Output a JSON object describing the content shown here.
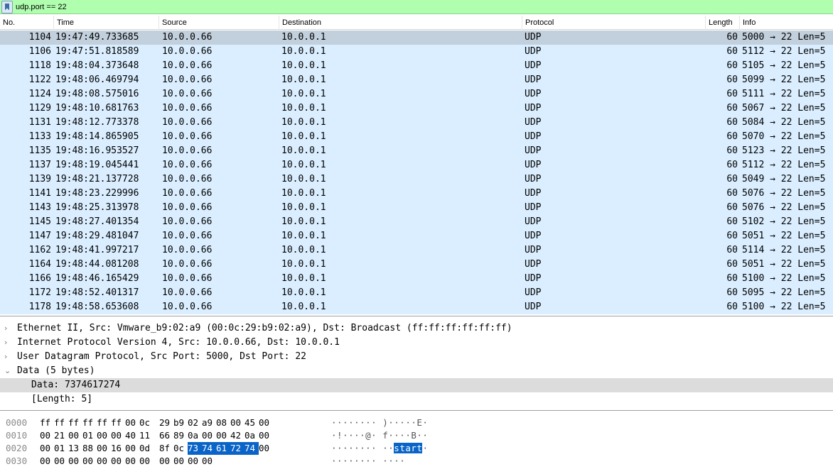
{
  "filter": {
    "value": "udp.port == 22"
  },
  "columns": [
    "No.",
    "Time",
    "Source",
    "Destination",
    "Protocol",
    "Length",
    "Info"
  ],
  "packets": [
    {
      "no": "1104",
      "time": "19:47:49.733685",
      "src": "10.0.0.66",
      "dst": "10.0.0.1",
      "proto": "UDP",
      "len": "60",
      "info": "5000 → 22 Len=5"
    },
    {
      "no": "1106",
      "time": "19:47:51.818589",
      "src": "10.0.0.66",
      "dst": "10.0.0.1",
      "proto": "UDP",
      "len": "60",
      "info": "5112 → 22 Len=5"
    },
    {
      "no": "1118",
      "time": "19:48:04.373648",
      "src": "10.0.0.66",
      "dst": "10.0.0.1",
      "proto": "UDP",
      "len": "60",
      "info": "5105 → 22 Len=5"
    },
    {
      "no": "1122",
      "time": "19:48:06.469794",
      "src": "10.0.0.66",
      "dst": "10.0.0.1",
      "proto": "UDP",
      "len": "60",
      "info": "5099 → 22 Len=5"
    },
    {
      "no": "1124",
      "time": "19:48:08.575016",
      "src": "10.0.0.66",
      "dst": "10.0.0.1",
      "proto": "UDP",
      "len": "60",
      "info": "5111 → 22 Len=5"
    },
    {
      "no": "1129",
      "time": "19:48:10.681763",
      "src": "10.0.0.66",
      "dst": "10.0.0.1",
      "proto": "UDP",
      "len": "60",
      "info": "5067 → 22 Len=5"
    },
    {
      "no": "1131",
      "time": "19:48:12.773378",
      "src": "10.0.0.66",
      "dst": "10.0.0.1",
      "proto": "UDP",
      "len": "60",
      "info": "5084 → 22 Len=5"
    },
    {
      "no": "1133",
      "time": "19:48:14.865905",
      "src": "10.0.0.66",
      "dst": "10.0.0.1",
      "proto": "UDP",
      "len": "60",
      "info": "5070 → 22 Len=5"
    },
    {
      "no": "1135",
      "time": "19:48:16.953527",
      "src": "10.0.0.66",
      "dst": "10.0.0.1",
      "proto": "UDP",
      "len": "60",
      "info": "5123 → 22 Len=5"
    },
    {
      "no": "1137",
      "time": "19:48:19.045441",
      "src": "10.0.0.66",
      "dst": "10.0.0.1",
      "proto": "UDP",
      "len": "60",
      "info": "5112 → 22 Len=5"
    },
    {
      "no": "1139",
      "time": "19:48:21.137728",
      "src": "10.0.0.66",
      "dst": "10.0.0.1",
      "proto": "UDP",
      "len": "60",
      "info": "5049 → 22 Len=5"
    },
    {
      "no": "1141",
      "time": "19:48:23.229996",
      "src": "10.0.0.66",
      "dst": "10.0.0.1",
      "proto": "UDP",
      "len": "60",
      "info": "5076 → 22 Len=5"
    },
    {
      "no": "1143",
      "time": "19:48:25.313978",
      "src": "10.0.0.66",
      "dst": "10.0.0.1",
      "proto": "UDP",
      "len": "60",
      "info": "5076 → 22 Len=5"
    },
    {
      "no": "1145",
      "time": "19:48:27.401354",
      "src": "10.0.0.66",
      "dst": "10.0.0.1",
      "proto": "UDP",
      "len": "60",
      "info": "5102 → 22 Len=5"
    },
    {
      "no": "1147",
      "time": "19:48:29.481047",
      "src": "10.0.0.66",
      "dst": "10.0.0.1",
      "proto": "UDP",
      "len": "60",
      "info": "5051 → 22 Len=5"
    },
    {
      "no": "1162",
      "time": "19:48:41.997217",
      "src": "10.0.0.66",
      "dst": "10.0.0.1",
      "proto": "UDP",
      "len": "60",
      "info": "5114 → 22 Len=5"
    },
    {
      "no": "1164",
      "time": "19:48:44.081208",
      "src": "10.0.0.66",
      "dst": "10.0.0.1",
      "proto": "UDP",
      "len": "60",
      "info": "5051 → 22 Len=5"
    },
    {
      "no": "1166",
      "time": "19:48:46.165429",
      "src": "10.0.0.66",
      "dst": "10.0.0.1",
      "proto": "UDP",
      "len": "60",
      "info": "5100 → 22 Len=5"
    },
    {
      "no": "1172",
      "time": "19:48:52.401317",
      "src": "10.0.0.66",
      "dst": "10.0.0.1",
      "proto": "UDP",
      "len": "60",
      "info": "5095 → 22 Len=5"
    },
    {
      "no": "1178",
      "time": "19:48:58.653608",
      "src": "10.0.0.66",
      "dst": "10.0.0.1",
      "proto": "UDP",
      "len": "60",
      "info": "5100 → 22 Len=5"
    }
  ],
  "selected_row": 0,
  "details": [
    {
      "text": "Ethernet II, Src: Vmware_b9:02:a9 (00:0c:29:b9:02:a9), Dst: Broadcast (ff:ff:ff:ff:ff:ff)",
      "arrow": "›",
      "sub": false,
      "highlight": false
    },
    {
      "text": "Internet Protocol Version 4, Src: 10.0.0.66, Dst: 10.0.0.1",
      "arrow": "›",
      "sub": false,
      "highlight": false
    },
    {
      "text": "User Datagram Protocol, Src Port: 5000, Dst Port: 22",
      "arrow": "›",
      "sub": false,
      "highlight": false
    },
    {
      "text": "Data (5 bytes)",
      "arrow": "⌄",
      "sub": false,
      "highlight": false
    },
    {
      "text": "Data: 7374617274",
      "arrow": "",
      "sub": true,
      "highlight": true
    },
    {
      "text": "[Length: 5]",
      "arrow": "",
      "sub": true,
      "highlight": false
    }
  ],
  "hex": [
    {
      "offset": "0000",
      "bytes": [
        "ff",
        "ff",
        "ff",
        "ff",
        "ff",
        "ff",
        "00",
        "0c",
        "29",
        "b9",
        "02",
        "a9",
        "08",
        "00",
        "45",
        "00"
      ],
      "ascii": "········ )·····E·",
      "sel": []
    },
    {
      "offset": "0010",
      "bytes": [
        "00",
        "21",
        "00",
        "01",
        "00",
        "00",
        "40",
        "11",
        "66",
        "89",
        "0a",
        "00",
        "00",
        "42",
        "0a",
        "00"
      ],
      "ascii": "·!····@· f····B··",
      "sel": []
    },
    {
      "offset": "0020",
      "bytes": [
        "00",
        "01",
        "13",
        "88",
        "00",
        "16",
        "00",
        "0d",
        "8f",
        "0c",
        "73",
        "74",
        "61",
        "72",
        "74",
        "00"
      ],
      "ascii_pre": "········ ··",
      "ascii_sel": "start",
      "ascii_post": "·",
      "sel": [
        10,
        11,
        12,
        13,
        14
      ]
    },
    {
      "offset": "0030",
      "bytes": [
        "00",
        "00",
        "00",
        "00",
        "00",
        "00",
        "00",
        "00",
        "00",
        "00",
        "00",
        "00"
      ],
      "ascii": "········ ····",
      "sel": []
    }
  ],
  "colors": {
    "filter_ok": "#afffaf",
    "row_bg": "#daeeff",
    "row_selected": "#c2cfdc",
    "hex_selected": "#0a64c8"
  }
}
